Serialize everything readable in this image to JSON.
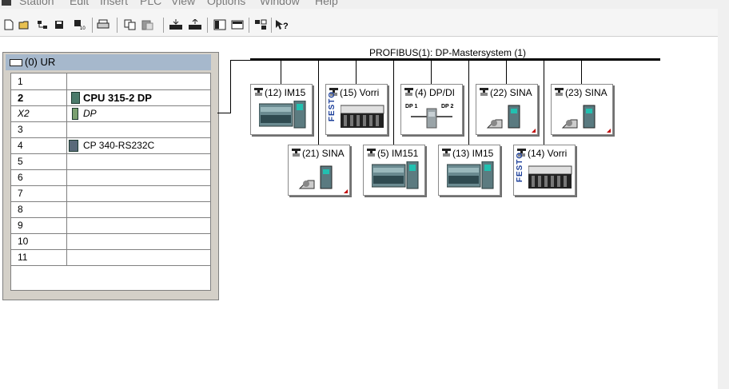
{
  "menu": {
    "items": [
      "Station",
      "Edit",
      "Insert",
      "PLC",
      "View",
      "Options",
      "Window",
      "Help"
    ]
  },
  "toolbar": {
    "buttons": [
      "new-icon",
      "open-icon",
      "accessible-nodes-icon",
      "save-icon",
      "save-compile-icon",
      "print-icon",
      "copy-icon",
      "paste-icon",
      "download-icon",
      "upload-icon",
      "catalog-icon",
      "overview-icon",
      "network-icon",
      "help-icon"
    ]
  },
  "rack": {
    "title": "(0) UR",
    "rows": [
      {
        "slot": "1",
        "module": ""
      },
      {
        "slot": "2",
        "module": "CPU 315-2 DP"
      },
      {
        "slot": "X2",
        "module": "DP"
      },
      {
        "slot": "3",
        "module": ""
      },
      {
        "slot": "4",
        "module": "CP 340-RS232C"
      },
      {
        "slot": "5",
        "module": ""
      },
      {
        "slot": "6",
        "module": ""
      },
      {
        "slot": "7",
        "module": ""
      },
      {
        "slot": "8",
        "module": ""
      },
      {
        "slot": "9",
        "module": ""
      },
      {
        "slot": "10",
        "module": ""
      },
      {
        "slot": "11",
        "module": ""
      }
    ]
  },
  "profibus": {
    "label": "PROFIBUS(1): DP-Mastersystem (1)",
    "nodes": [
      {
        "label": "(12) IM15",
        "kind": "et200"
      },
      {
        "label": "(15) Vorri",
        "kind": "festo"
      },
      {
        "label": "(4) DP/DI",
        "kind": "coupler",
        "coupler_left": "DP 1",
        "coupler_right": "DP 2"
      },
      {
        "label": "(22) SINA",
        "kind": "drive"
      },
      {
        "label": "(23) SINA",
        "kind": "drive"
      },
      {
        "label": "(21) SINA",
        "kind": "drive"
      },
      {
        "label": "(5) IM151",
        "kind": "et200"
      },
      {
        "label": "(13) IM15",
        "kind": "et200"
      },
      {
        "label": "(14) Vorri",
        "kind": "festo"
      }
    ],
    "festo_text": "FESTO"
  },
  "colors": {
    "rack_title_bg": "#a6b8cc",
    "rack_bg": "#d4d0c8",
    "festo_blue": "#1c3f9a",
    "corner_red": "#c00000",
    "module_green": "#4a7a6a"
  }
}
